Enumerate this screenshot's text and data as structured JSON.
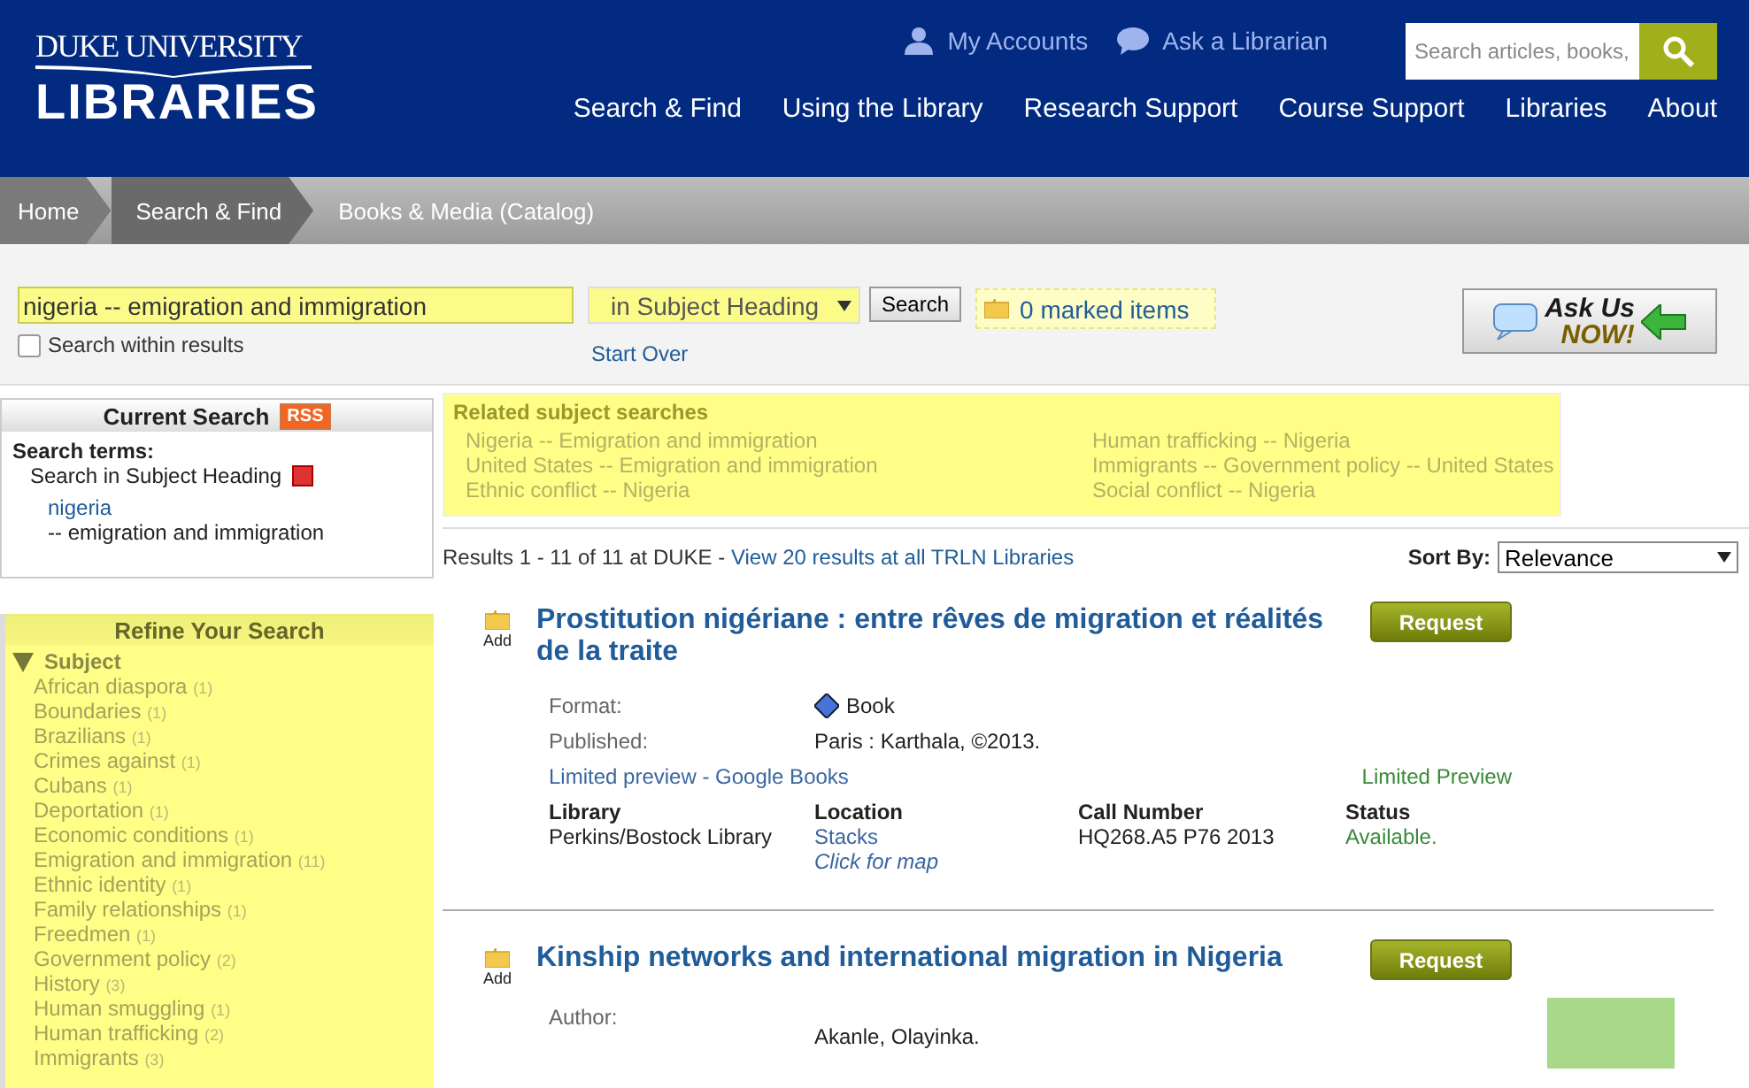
{
  "header": {
    "logo": {
      "line1": "DUKE UNIVERSITY",
      "line2": "LIBRARIES"
    },
    "utility_links": [
      {
        "kind": "person",
        "label": "My Accounts"
      },
      {
        "kind": "chat",
        "label": "Ask a Librarian"
      }
    ],
    "search": {
      "placeholder": "Search articles, books,"
    },
    "nav": [
      "Search & Find",
      "Using the Library",
      "Research Support",
      "Course Support",
      "Libraries",
      "About"
    ]
  },
  "breadcrumb": [
    "Home",
    "Search & Find",
    "Books & Media (Catalog)"
  ],
  "search_bar": {
    "query": "nigeria -- emigration and immigration",
    "scope": "in Subject Heading",
    "button": "Search",
    "within_results": {
      "label": "Search within results",
      "checked": false
    },
    "start_over": "Start Over",
    "marked_items": "0 marked items",
    "ask_us": {
      "line1": "Ask Us",
      "line2": "NOW!"
    }
  },
  "current_search": {
    "title": "Current Search",
    "rss": "RSS",
    "terms_label": "Search terms:",
    "heading": "Search in Subject Heading",
    "term": "nigeria",
    "term_rest": "--  emigration and immigration"
  },
  "related": {
    "title": "Related subject searches",
    "columns": [
      [
        "Nigeria -- Emigration and immigration",
        "United States -- Emigration and immigration",
        "Ethnic conflict -- Nigeria"
      ],
      [
        "Human trafficking -- Nigeria",
        "Immigrants -- Government policy -- United States",
        "Social conflict -- Nigeria"
      ]
    ]
  },
  "results_summary": {
    "text": "Results 1 - 11 of 11 at DUKE - ",
    "link": "View 20 results at all TRLN Libraries"
  },
  "sort": {
    "label": "Sort By:",
    "value": "Relevance"
  },
  "refine": {
    "title": "Refine Your Search",
    "facet": {
      "label": "Subject",
      "expanded": true,
      "items": [
        {
          "label": "African diaspora",
          "count": "(1)"
        },
        {
          "label": "Boundaries",
          "count": "(1)"
        },
        {
          "label": "Brazilians",
          "count": "(1)"
        },
        {
          "label": "Crimes against",
          "count": "(1)"
        },
        {
          "label": "Cubans",
          "count": "(1)"
        },
        {
          "label": "Deportation",
          "count": "(1)"
        },
        {
          "label": "Economic conditions",
          "count": "(1)"
        },
        {
          "label": "Emigration and immigration",
          "count": "(11)"
        },
        {
          "label": "Ethnic identity",
          "count": "(1)"
        },
        {
          "label": "Family relationships",
          "count": "(1)"
        },
        {
          "label": "Freedmen",
          "count": "(1)"
        },
        {
          "label": "Government policy",
          "count": "(2)"
        },
        {
          "label": "History",
          "count": "(3)"
        },
        {
          "label": "Human smuggling",
          "count": "(1)"
        },
        {
          "label": "Human trafficking",
          "count": "(2)"
        },
        {
          "label": "Immigrants",
          "count": "(3)"
        }
      ]
    }
  },
  "results": [
    {
      "add_label": "Add",
      "title": "Prostitution nigériane : entre rêves de migration et réalités de la traite",
      "request": "Request",
      "fields": [
        {
          "label": "Format:",
          "value": "Book",
          "kind": "format"
        },
        {
          "label": "Published:",
          "value": "Paris : Karthala, ©2013.",
          "kind": "text"
        }
      ],
      "preview": {
        "link": "Limited preview - Google Books",
        "status": "Limited Preview"
      },
      "holdings": {
        "headers": [
          "Library",
          "Location",
          "Call Number",
          "Status"
        ],
        "library": "Perkins/Bostock Library",
        "location": "Stacks",
        "map": "Click for map",
        "call_number": "HQ268.A5 P76 2013",
        "status": "Available."
      }
    },
    {
      "add_label": "Add",
      "title": "Kinship networks and international migration in Nigeria",
      "request": "Request",
      "thumbnail": true,
      "fields": [
        {
          "label": "Author:",
          "value": "Akanle, Olayinka.",
          "kind": "text"
        }
      ]
    }
  ]
}
